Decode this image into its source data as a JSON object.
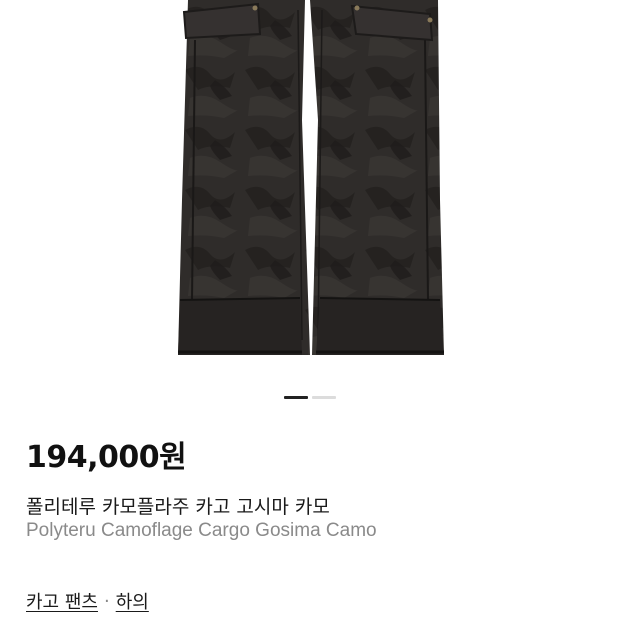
{
  "product": {
    "image_icon": "cargo-pants-photo",
    "image_colors": {
      "fabric": "#2e2b29",
      "shadow": "#1c1a19",
      "highlight": "#4a4542"
    },
    "carousel": {
      "total": 2,
      "active": 1
    },
    "price": "194,000원",
    "title_ko": "폴리테루 카모플라주 카고 고시마 카모",
    "title_en": "Polyteru Camoflage Cargo Gosima Camo"
  },
  "breadcrumb": {
    "items": [
      "카고 팬츠",
      "하의"
    ],
    "separator": "·"
  }
}
